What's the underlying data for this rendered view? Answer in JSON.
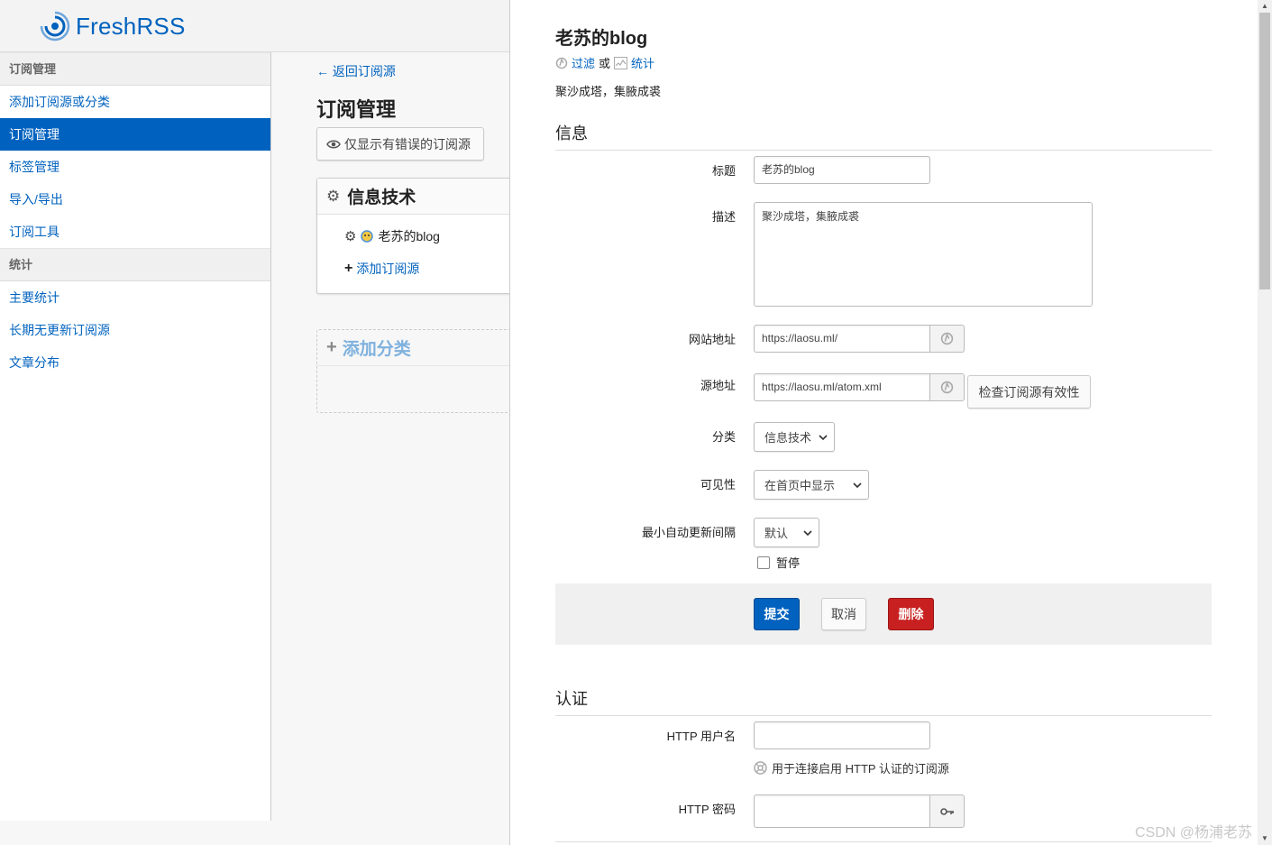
{
  "app": {
    "name": "FreshRSS"
  },
  "sidebar": {
    "sections": [
      {
        "heading": "订阅管理",
        "items": [
          {
            "label": "添加订阅源或分类",
            "active": false
          },
          {
            "label": "订阅管理",
            "active": true
          },
          {
            "label": "标签管理",
            "active": false
          },
          {
            "label": "导入/导出",
            "active": false
          },
          {
            "label": "订阅工具",
            "active": false
          }
        ]
      },
      {
        "heading": "统计",
        "items": [
          {
            "label": "主要统计",
            "active": false
          },
          {
            "label": "长期无更新订阅源",
            "active": false
          },
          {
            "label": "文章分布",
            "active": false
          }
        ]
      }
    ]
  },
  "middle": {
    "back_link": "← 返回订阅源",
    "title": "订阅管理",
    "error_filter_button": "仅显示有错误的订阅源",
    "category": {
      "name": "信息技术",
      "feeds": [
        "老苏的blog"
      ],
      "add_feed": "添加订阅源"
    },
    "add_category": "添加分类"
  },
  "panel": {
    "title": "老苏的blog",
    "filter_link": "过滤",
    "or_text": "或",
    "stats_link": "统计",
    "description": "聚沙成塔，集腋成裘",
    "info_section": {
      "title": "信息",
      "fields": {
        "title_label": "标题",
        "title_value": "老苏的blog",
        "desc_label": "描述",
        "desc_value": "聚沙成塔，集腋成裘",
        "website_label": "网站地址",
        "website_value": "https://laosu.ml/",
        "feed_label": "源地址",
        "feed_value": "https://laosu.ml/atom.xml",
        "check_button": "检查订阅源有效性",
        "category_label": "分类",
        "category_value": "信息技术",
        "visibility_label": "可见性",
        "visibility_value": "在首页中显示",
        "ttl_label": "最小自动更新间隔",
        "ttl_value": "默认",
        "pause_label": "暂停",
        "pause_checked": false
      },
      "buttons": {
        "submit": "提交",
        "cancel": "取消",
        "delete": "删除"
      }
    },
    "auth_section": {
      "title": "认证",
      "username_label": "HTTP 用户名",
      "username_value": "",
      "help_text": "用于连接启用 HTTP 认证的订阅源",
      "password_label": "HTTP 密码",
      "password_value": ""
    }
  },
  "watermark": "CSDN @杨浦老苏",
  "colors": {
    "accent": "#0062be",
    "danger": "#c82020"
  }
}
